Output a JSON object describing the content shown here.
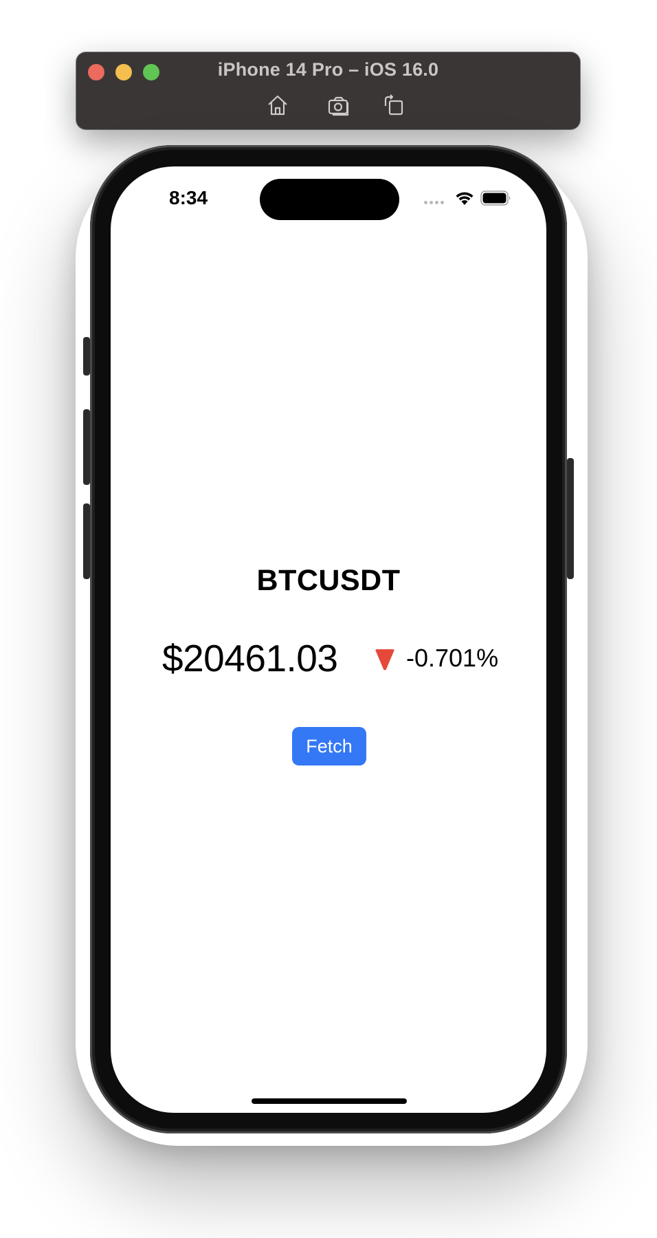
{
  "window": {
    "title": "iPhone 14 Pro – iOS 16.0",
    "traffic_lights": {
      "close_color": "#ec6a5e",
      "minimize_color": "#f4bf4f",
      "zoom_color": "#61c554"
    },
    "toolbar_icons": [
      "home-icon",
      "screenshot-icon",
      "rotate-icon"
    ]
  },
  "status_bar": {
    "time": "8:34",
    "icons": [
      "cellular-signal-icon",
      "wifi-icon",
      "battery-icon"
    ]
  },
  "ticker": {
    "symbol": "BTCUSDT",
    "price": "$20461.03",
    "change_percent": "-0.701%",
    "direction_icon": "down-triangle-icon",
    "direction_color": "#e5493a"
  },
  "actions": {
    "fetch_label": "Fetch",
    "fetch_color": "#3478f6"
  }
}
